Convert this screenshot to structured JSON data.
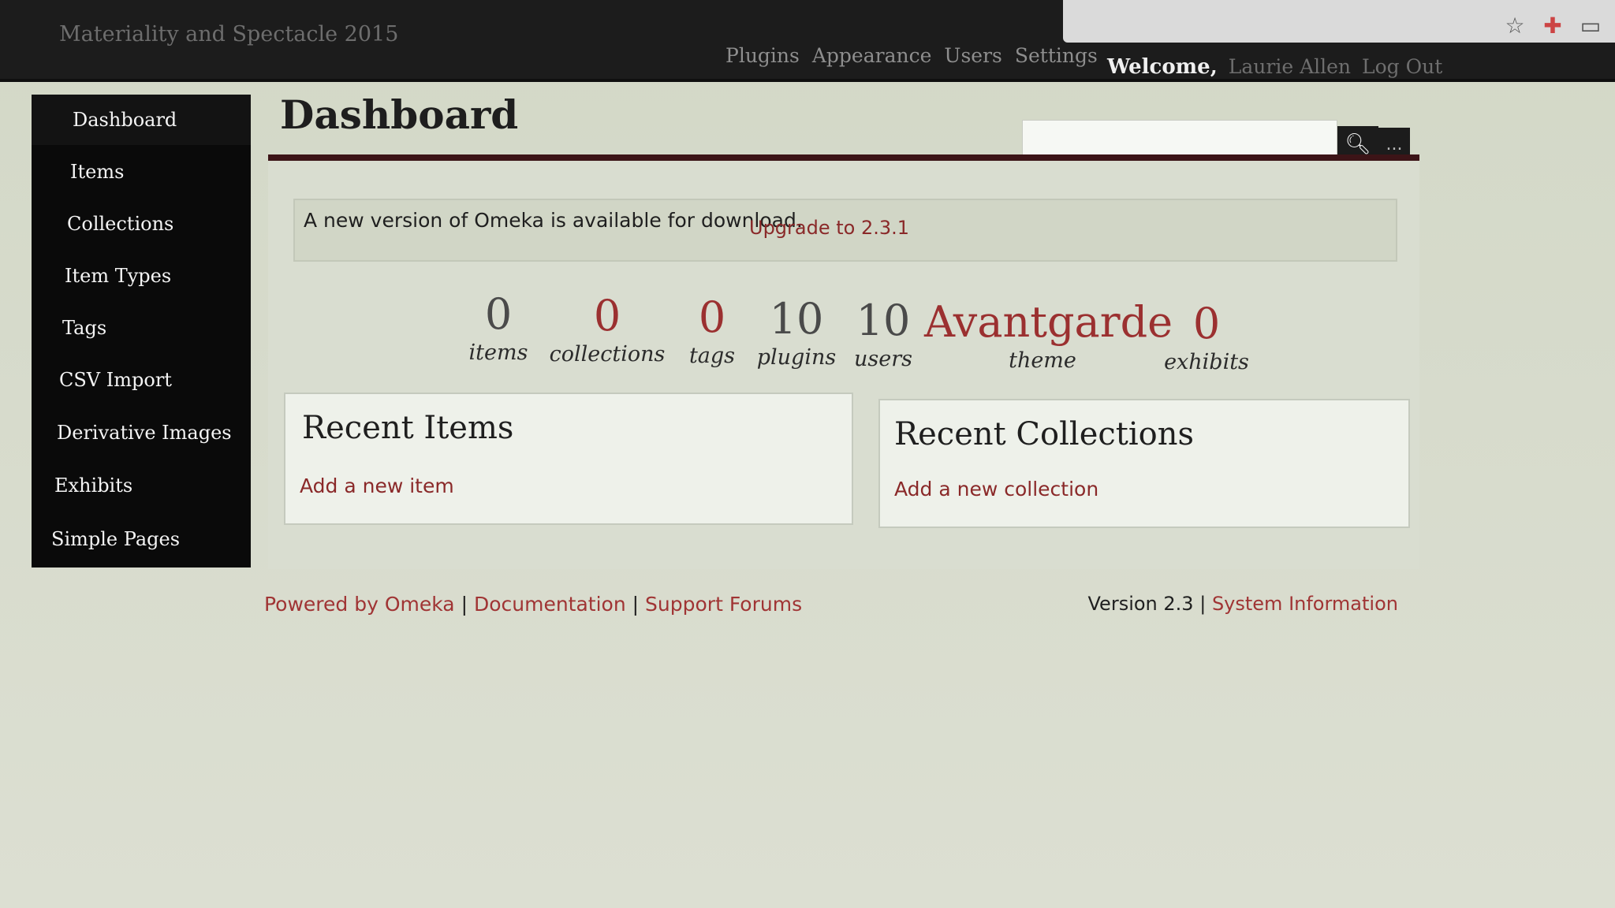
{
  "topbar": {
    "site_title": "Materiality and Spectacle 2015",
    "nav": [
      "Plugins",
      "Appearance",
      "Users",
      "Settings"
    ],
    "welcome": "Welcome,",
    "user_name": "Laurie Allen",
    "logout": "Log Out"
  },
  "browser": {
    "icons": [
      "star-icon",
      "extension-icon",
      "window-icon"
    ]
  },
  "sidebar": {
    "items": [
      {
        "label": "Dashboard"
      },
      {
        "label": "Items"
      },
      {
        "label": "Collections"
      },
      {
        "label": "Item Types"
      },
      {
        "label": "Tags"
      },
      {
        "label": "CSV Import"
      },
      {
        "label": "Derivative Images"
      },
      {
        "label": "Exhibits"
      },
      {
        "label": "Simple Pages"
      }
    ]
  },
  "main": {
    "title": "Dashboard",
    "search": {
      "value": "",
      "button_icon": "search-icon",
      "options_label": "..."
    },
    "notice": {
      "text": "A new version of Omeka is available for download.",
      "link": "Upgrade to 2.3.1"
    },
    "stats": [
      {
        "count": "0",
        "label": "items"
      },
      {
        "count": "0",
        "label": "collections"
      },
      {
        "count": "0",
        "label": "tags"
      },
      {
        "count": "10",
        "label": "plugins"
      },
      {
        "count": "10",
        "label": "users"
      },
      {
        "count": "Avantgarde",
        "label": "theme"
      },
      {
        "count": "0",
        "label": "exhibits"
      }
    ],
    "recent_items": {
      "title": "Recent Items",
      "link": "Add a new item"
    },
    "recent_collections": {
      "title": "Recent Collections",
      "link": "Add a new collection"
    }
  },
  "footer": {
    "powered_by": "Powered by Omeka",
    "sep1": "|",
    "documentation": "Documentation",
    "sep2": "|",
    "support": "Support Forums",
    "version": "Version 2.3",
    "sep3": "|",
    "system_info": "System Information"
  },
  "colors": {
    "accent": "#9b3030",
    "topbar": "#1c1c1c",
    "sidebar": "#0a0a0a",
    "background": "#d7dbcc"
  }
}
